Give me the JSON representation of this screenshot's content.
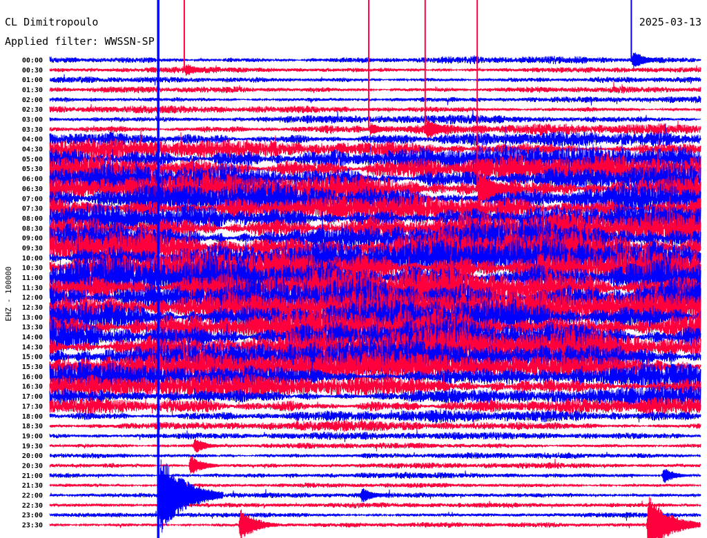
{
  "chart_data": {
    "type": "line",
    "title": "CL Dimitropoulo",
    "subtitle": "Applied filter: WWSSN-SP",
    "date": "2025-03-13",
    "ylabel": "EHZ - 100000",
    "xlabel": "",
    "grid": false,
    "legend": "none",
    "series_colors": [
      "#0000ff",
      "#ff003c"
    ],
    "row_labels": [
      "00:00",
      "00:30",
      "01:00",
      "01:30",
      "02:00",
      "02:30",
      "03:00",
      "03:30",
      "04:00",
      "04:30",
      "05:00",
      "05:30",
      "06:00",
      "06:30",
      "07:00",
      "07:30",
      "08:00",
      "08:30",
      "09:00",
      "09:30",
      "10:00",
      "10:30",
      "11:00",
      "11:30",
      "12:00",
      "12:30",
      "13:00",
      "13:30",
      "14:00",
      "14:30",
      "15:00",
      "15:30",
      "16:00",
      "16:30",
      "17:00",
      "17:30",
      "18:00",
      "18:30",
      "19:00",
      "19:30",
      "20:00",
      "20:30",
      "21:00",
      "21:30",
      "22:00",
      "22:30",
      "23:00",
      "23:30"
    ],
    "relative_amplitude": [
      0.15,
      0.12,
      0.12,
      0.13,
      0.13,
      0.15,
      0.18,
      0.22,
      0.3,
      0.4,
      0.55,
      0.6,
      0.6,
      0.65,
      0.65,
      0.6,
      0.6,
      0.65,
      0.7,
      0.75,
      0.75,
      0.8,
      0.85,
      0.85,
      0.8,
      0.8,
      0.8,
      0.8,
      0.75,
      0.75,
      0.7,
      0.65,
      0.55,
      0.5,
      0.4,
      0.35,
      0.25,
      0.2,
      0.15,
      0.12,
      0.12,
      0.12,
      0.12,
      0.1,
      0.1,
      0.1,
      0.1,
      0.1
    ],
    "events": [
      {
        "row": "22:00",
        "minute": 5.0,
        "reach": "full",
        "burst": 1.6
      },
      {
        "row": "00:30",
        "minute": 6.2,
        "reach": "top",
        "burst": 0.3
      },
      {
        "row": "03:30",
        "minute": 14.7,
        "reach": "top",
        "burst": 0.3
      },
      {
        "row": "03:30",
        "minute": 17.3,
        "reach": "top",
        "burst": 0.5
      },
      {
        "row": "06:30",
        "minute": 19.7,
        "reach": "top",
        "burst": 0.8
      },
      {
        "row": "00:00",
        "minute": 26.8,
        "reach": "top",
        "burst": 0.4
      },
      {
        "row": "23:30",
        "minute": 27.5,
        "reach": "none",
        "burst": 1.2
      },
      {
        "row": "23:30",
        "minute": 8.7,
        "reach": "none",
        "burst": 0.7
      },
      {
        "row": "22:00",
        "minute": 14.3,
        "reach": "none",
        "burst": 0.35
      },
      {
        "row": "20:30",
        "minute": 6.4,
        "reach": "none",
        "burst": 0.45
      },
      {
        "row": "19:30",
        "minute": 6.6,
        "reach": "none",
        "burst": 0.35
      },
      {
        "row": "21:00",
        "minute": 28.2,
        "reach": "none",
        "burst": 0.35
      }
    ]
  }
}
